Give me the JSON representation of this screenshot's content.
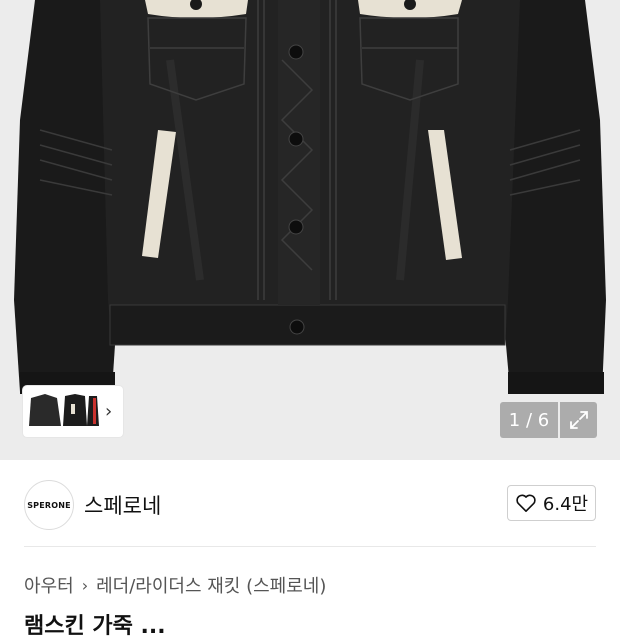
{
  "gallery": {
    "counter_text": "1 / 6",
    "thumb_chevron": "›"
  },
  "brand": {
    "logo_text": "SPERONE",
    "name": "스페로네",
    "like_count": "6.4만"
  },
  "breadcrumb": {
    "items": [
      "아우터",
      "레더/라이더스 재킷 (스페로네)"
    ],
    "separator": "›"
  },
  "product": {
    "title_partial": "램스킨 가죽 ..."
  },
  "colors": {
    "jacket": "#1e1e1e",
    "accent_panel": "#e7e1d3",
    "hero_bg": "#ececec"
  }
}
